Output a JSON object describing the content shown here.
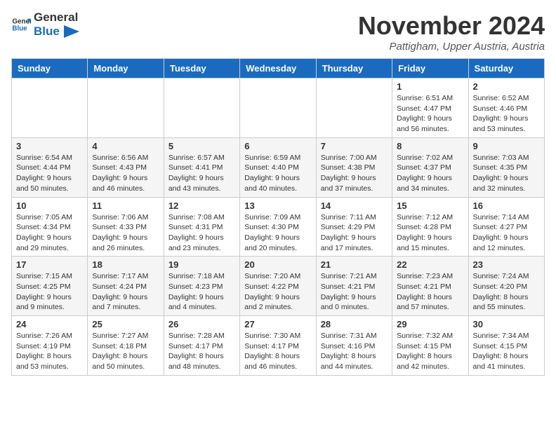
{
  "header": {
    "logo_general": "General",
    "logo_blue": "Blue",
    "title": "November 2024",
    "subtitle": "Pattigham, Upper Austria, Austria"
  },
  "calendar": {
    "days_of_week": [
      "Sunday",
      "Monday",
      "Tuesday",
      "Wednesday",
      "Thursday",
      "Friday",
      "Saturday"
    ],
    "weeks": [
      [
        {
          "day": "",
          "info": ""
        },
        {
          "day": "",
          "info": ""
        },
        {
          "day": "",
          "info": ""
        },
        {
          "day": "",
          "info": ""
        },
        {
          "day": "",
          "info": ""
        },
        {
          "day": "1",
          "info": "Sunrise: 6:51 AM\nSunset: 4:47 PM\nDaylight: 9 hours and 56 minutes."
        },
        {
          "day": "2",
          "info": "Sunrise: 6:52 AM\nSunset: 4:46 PM\nDaylight: 9 hours and 53 minutes."
        }
      ],
      [
        {
          "day": "3",
          "info": "Sunrise: 6:54 AM\nSunset: 4:44 PM\nDaylight: 9 hours and 50 minutes."
        },
        {
          "day": "4",
          "info": "Sunrise: 6:56 AM\nSunset: 4:43 PM\nDaylight: 9 hours and 46 minutes."
        },
        {
          "day": "5",
          "info": "Sunrise: 6:57 AM\nSunset: 4:41 PM\nDaylight: 9 hours and 43 minutes."
        },
        {
          "day": "6",
          "info": "Sunrise: 6:59 AM\nSunset: 4:40 PM\nDaylight: 9 hours and 40 minutes."
        },
        {
          "day": "7",
          "info": "Sunrise: 7:00 AM\nSunset: 4:38 PM\nDaylight: 9 hours and 37 minutes."
        },
        {
          "day": "8",
          "info": "Sunrise: 7:02 AM\nSunset: 4:37 PM\nDaylight: 9 hours and 34 minutes."
        },
        {
          "day": "9",
          "info": "Sunrise: 7:03 AM\nSunset: 4:35 PM\nDaylight: 9 hours and 32 minutes."
        }
      ],
      [
        {
          "day": "10",
          "info": "Sunrise: 7:05 AM\nSunset: 4:34 PM\nDaylight: 9 hours and 29 minutes."
        },
        {
          "day": "11",
          "info": "Sunrise: 7:06 AM\nSunset: 4:33 PM\nDaylight: 9 hours and 26 minutes."
        },
        {
          "day": "12",
          "info": "Sunrise: 7:08 AM\nSunset: 4:31 PM\nDaylight: 9 hours and 23 minutes."
        },
        {
          "day": "13",
          "info": "Sunrise: 7:09 AM\nSunset: 4:30 PM\nDaylight: 9 hours and 20 minutes."
        },
        {
          "day": "14",
          "info": "Sunrise: 7:11 AM\nSunset: 4:29 PM\nDaylight: 9 hours and 17 minutes."
        },
        {
          "day": "15",
          "info": "Sunrise: 7:12 AM\nSunset: 4:28 PM\nDaylight: 9 hours and 15 minutes."
        },
        {
          "day": "16",
          "info": "Sunrise: 7:14 AM\nSunset: 4:27 PM\nDaylight: 9 hours and 12 minutes."
        }
      ],
      [
        {
          "day": "17",
          "info": "Sunrise: 7:15 AM\nSunset: 4:25 PM\nDaylight: 9 hours and 9 minutes."
        },
        {
          "day": "18",
          "info": "Sunrise: 7:17 AM\nSunset: 4:24 PM\nDaylight: 9 hours and 7 minutes."
        },
        {
          "day": "19",
          "info": "Sunrise: 7:18 AM\nSunset: 4:23 PM\nDaylight: 9 hours and 4 minutes."
        },
        {
          "day": "20",
          "info": "Sunrise: 7:20 AM\nSunset: 4:22 PM\nDaylight: 9 hours and 2 minutes."
        },
        {
          "day": "21",
          "info": "Sunrise: 7:21 AM\nSunset: 4:21 PM\nDaylight: 9 hours and 0 minutes."
        },
        {
          "day": "22",
          "info": "Sunrise: 7:23 AM\nSunset: 4:21 PM\nDaylight: 8 hours and 57 minutes."
        },
        {
          "day": "23",
          "info": "Sunrise: 7:24 AM\nSunset: 4:20 PM\nDaylight: 8 hours and 55 minutes."
        }
      ],
      [
        {
          "day": "24",
          "info": "Sunrise: 7:26 AM\nSunset: 4:19 PM\nDaylight: 8 hours and 53 minutes."
        },
        {
          "day": "25",
          "info": "Sunrise: 7:27 AM\nSunset: 4:18 PM\nDaylight: 8 hours and 50 minutes."
        },
        {
          "day": "26",
          "info": "Sunrise: 7:28 AM\nSunset: 4:17 PM\nDaylight: 8 hours and 48 minutes."
        },
        {
          "day": "27",
          "info": "Sunrise: 7:30 AM\nSunset: 4:17 PM\nDaylight: 8 hours and 46 minutes."
        },
        {
          "day": "28",
          "info": "Sunrise: 7:31 AM\nSunset: 4:16 PM\nDaylight: 8 hours and 44 minutes."
        },
        {
          "day": "29",
          "info": "Sunrise: 7:32 AM\nSunset: 4:15 PM\nDaylight: 8 hours and 42 minutes."
        },
        {
          "day": "30",
          "info": "Sunrise: 7:34 AM\nSunset: 4:15 PM\nDaylight: 8 hours and 41 minutes."
        }
      ]
    ]
  }
}
